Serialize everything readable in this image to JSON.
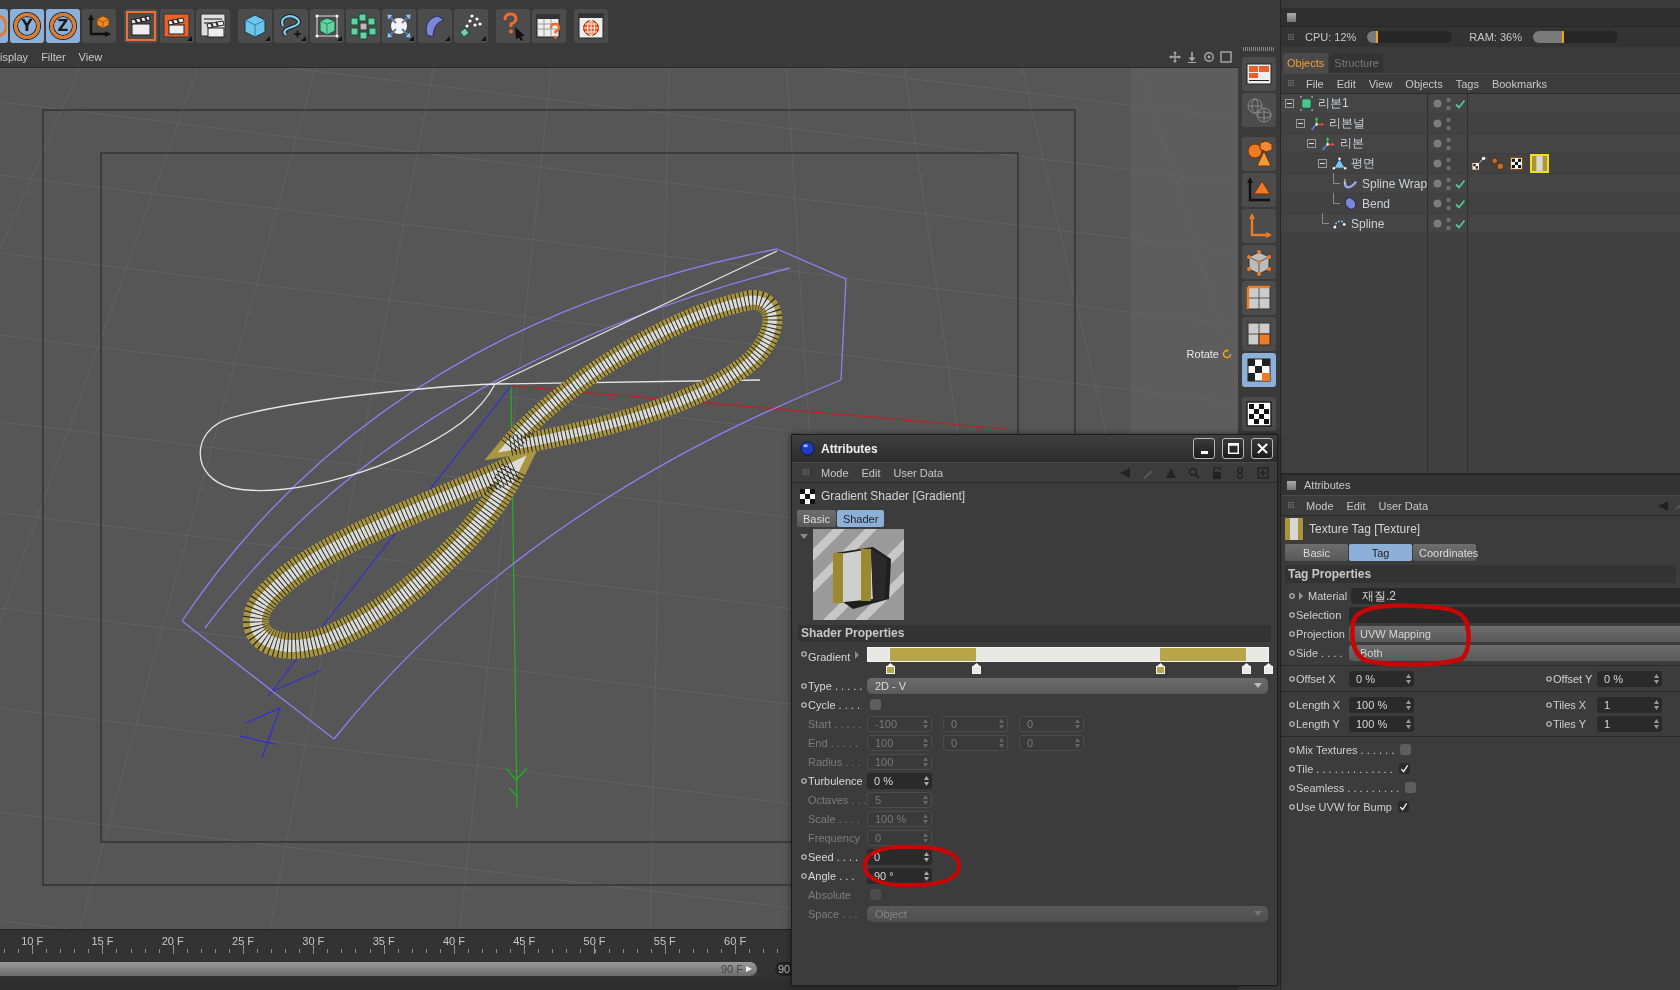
{
  "toolbar": {
    "groups": [
      [
        {
          "kind": "axis",
          "selected": true
        },
        {
          "kind": "axis",
          "label": "Y",
          "selected": true
        },
        {
          "kind": "axis",
          "label": "Z",
          "selected": true
        },
        {
          "kind": "coordinates",
          "selected": false
        }
      ],
      [
        {
          "kind": "render-view",
          "selected": false
        },
        {
          "kind": "render-picture",
          "selected": false
        },
        {
          "kind": "render-settings",
          "selected": false
        }
      ],
      [
        {
          "kind": "cube",
          "selected": false
        },
        {
          "kind": "spline-pen",
          "selected": false
        },
        {
          "kind": "subdivision",
          "selected": false
        },
        {
          "kind": "cloner",
          "selected": false
        },
        {
          "kind": "scene",
          "selected": false
        },
        {
          "kind": "deformer",
          "selected": false
        },
        {
          "kind": "particles",
          "selected": false
        }
      ],
      [
        {
          "kind": "help",
          "selected": false
        },
        {
          "kind": "help-table",
          "selected": false
        }
      ],
      [
        {
          "kind": "globe",
          "selected": false
        }
      ]
    ]
  },
  "viewport": {
    "menu": [
      "isplay",
      "Filter",
      "View"
    ],
    "hud_label": "Rotate"
  },
  "timeline": {
    "frame_labels": [
      "10 F",
      "15 F",
      "20 F",
      "25 F",
      "30 F",
      "35 F",
      "40 F",
      "45 F",
      "50 F",
      "55 F",
      "60 F"
    ],
    "range_end": "90 F",
    "end_field": "90"
  },
  "palette": {
    "groups": [
      [
        {
          "kind": "layout",
          "selected": false
        },
        {
          "kind": "sphere-grid",
          "selected": false
        }
      ],
      [
        {
          "kind": "model",
          "selected": false
        },
        {
          "kind": "object-axis",
          "selected": false
        },
        {
          "kind": "axis",
          "selected": false
        },
        {
          "kind": "points",
          "selected": false
        },
        {
          "kind": "edges",
          "selected": false
        },
        {
          "kind": "polygons",
          "selected": false
        },
        {
          "kind": "uv",
          "selected": true
        }
      ],
      [
        {
          "kind": "checker",
          "selected": false
        }
      ]
    ]
  },
  "monitor": {
    "cpu": {
      "label": "CPU: 12%",
      "level": 0.12
    },
    "ram": {
      "label": "RAM: 36%",
      "level": 0.36
    }
  },
  "objects_manager": {
    "tabs": [
      {
        "label": "Objects",
        "selected": true
      },
      {
        "label": "Structure",
        "selected": false
      }
    ],
    "menu": [
      "File",
      "Edit",
      "View",
      "Objects",
      "Tags",
      "Bookmarks"
    ],
    "tree": [
      {
        "name": "리본1",
        "kind": "sweep",
        "checked": true,
        "expanded": true,
        "children": [
          {
            "name": "리본널",
            "kind": "null",
            "checked": false,
            "expanded": true,
            "children": [
              {
                "name": "리본",
                "kind": "null",
                "checked": false,
                "expanded": true,
                "children": [
                  {
                    "name": "평면",
                    "kind": "plane",
                    "checked": false,
                    "expanded": true,
                    "tags": [
                      {
                        "kind": "uvw",
                        "selected": false
                      },
                      {
                        "kind": "phong",
                        "selected": false
                      },
                      {
                        "kind": "checker-texture",
                        "selected": false
                      },
                      {
                        "kind": "texture",
                        "selected": true
                      }
                    ],
                    "children": [
                      {
                        "name": "Spline Wrap",
                        "kind": "spline-wrap",
                        "checked": true
                      },
                      {
                        "name": "Bend",
                        "kind": "bend",
                        "checked": true
                      }
                    ]
                  },
                  {
                    "name": "Spline",
                    "kind": "spline",
                    "checked": true
                  }
                ]
              }
            ]
          }
        ]
      }
    ]
  },
  "attributes_panel": {
    "title": "Attributes",
    "menu": [
      "Mode",
      "Edit",
      "User Data"
    ],
    "object": {
      "kind": "texture",
      "label": "Texture Tag [Texture]"
    },
    "tabs": [
      {
        "label": "Basic",
        "selected": false
      },
      {
        "label": "Tag",
        "selected": true
      },
      {
        "label": "Coordinates",
        "selected": false
      }
    ],
    "section": "Tag Properties",
    "groups": [
      [
        {
          "kind": "link",
          "label": "Material",
          "expanded": false,
          "value": "재질.2"
        },
        {
          "kind": "text",
          "label": "Selection"
        },
        {
          "kind": "dropdown",
          "label": "Projection",
          "value": "UVW Mapping"
        },
        {
          "kind": "dropdown",
          "label": "Side . . . .",
          "value": "Both"
        }
      ],
      [
        {
          "kind": "pair",
          "left": {
            "label": "Offset X",
            "value": "0 %"
          },
          "right": {
            "label": "Offset Y",
            "value": "0 %"
          }
        }
      ],
      [
        {
          "kind": "pair",
          "left": {
            "label": "Length X",
            "value": "100 %"
          },
          "right": {
            "label": "Tiles X",
            "value": "1"
          }
        },
        {
          "kind": "pair",
          "left": {
            "label": "Length Y",
            "value": "100 %"
          },
          "right": {
            "label": "Tiles Y",
            "value": "1"
          }
        }
      ],
      [
        {
          "kind": "checkbox",
          "label": "Mix Textures . . . . . .",
          "checked": false
        },
        {
          "kind": "checkbox",
          "label": "Tile . . . . . . . . . . . . .",
          "checked": true
        },
        {
          "kind": "checkbox",
          "label": "Seamless . . . . . . . . .",
          "checked": false
        },
        {
          "kind": "checkbox",
          "label": "Use UVW for Bump",
          "checked": true
        }
      ]
    ],
    "annotations": [
      {
        "kind": "hand-drawn-loop"
      }
    ]
  },
  "attributes_window": {
    "title": "Attributes",
    "menu": [
      "Mode",
      "Edit",
      "User Data"
    ],
    "object": {
      "kind": "gradient",
      "label": "Gradient Shader [Gradient]"
    },
    "tabs": [
      {
        "label": "Basic",
        "selected": false
      },
      {
        "label": "Shader",
        "selected": true
      }
    ],
    "preview": {
      "expanded": true
    },
    "section": "Shader Properties",
    "fields": [
      {
        "kind": "gradient",
        "label": "Gradient",
        "expanded": false,
        "disabled": false,
        "knots": [
          {
            "color": "#b8a54a",
            "level": 0.055
          },
          {
            "color": "#e8e8e4",
            "level": 0.27
          },
          {
            "color": "#b8a54a",
            "level": 0.73
          },
          {
            "color": "#e8e8e4",
            "level": 0.945
          },
          {
            "color": "#e8e8e4",
            "level": 1
          }
        ]
      },
      {
        "kind": "dropdown",
        "label": "Type . . . . .",
        "value": "2D - V",
        "disabled": false
      },
      {
        "kind": "checkbox",
        "label": "Cycle . . . .",
        "checked": false,
        "disabled": false
      },
      {
        "kind": "vector",
        "label": "Start . . . . .",
        "values": [
          "-100",
          "0",
          "0"
        ],
        "disabled": true
      },
      {
        "kind": "vector",
        "label": "End . . . . .",
        "values": [
          "100",
          "0",
          "0"
        ],
        "disabled": true
      },
      {
        "kind": "number",
        "label": "Radius . . .",
        "value": "100",
        "disabled": true
      },
      {
        "kind": "number",
        "label": "Turbulence",
        "value": "0 %",
        "disabled": false
      },
      {
        "kind": "number",
        "label": "Octaves . . .",
        "value": "5",
        "disabled": true
      },
      {
        "kind": "number",
        "label": "Scale . . . .",
        "value": "100 %",
        "disabled": true
      },
      {
        "kind": "number",
        "label": "Frequency",
        "value": "0",
        "disabled": true
      },
      {
        "kind": "number",
        "label": "Seed . . . .",
        "value": "0",
        "disabled": false
      },
      {
        "kind": "number",
        "label": "Angle . . .",
        "value": "90 °",
        "disabled": false
      },
      {
        "kind": "checkbox",
        "label": "Absolute",
        "checked": false,
        "disabled": true
      },
      {
        "kind": "dropdown",
        "label": "Space . . .",
        "value": "Object",
        "disabled": true
      }
    ],
    "annotations": [
      {
        "kind": "hand-drawn-loop"
      }
    ]
  }
}
